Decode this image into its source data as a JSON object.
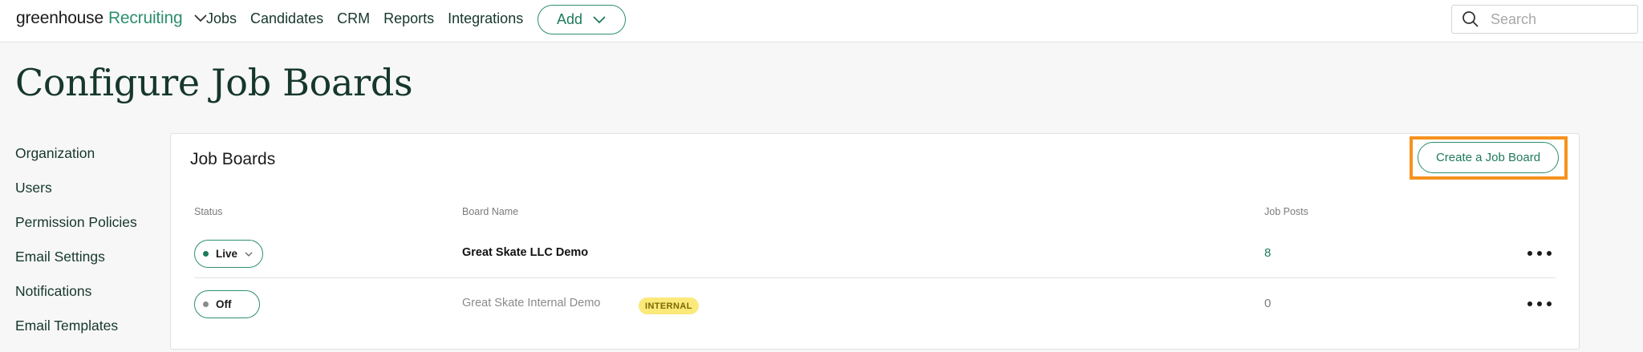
{
  "topbar": {
    "brand": "greenhouse",
    "product": "Recruiting",
    "nav": [
      {
        "label": "Jobs"
      },
      {
        "label": "Candidates"
      },
      {
        "label": "CRM"
      },
      {
        "label": "Reports"
      },
      {
        "label": "Integrations"
      }
    ],
    "add_label": "Add",
    "search_placeholder": "Search"
  },
  "page": {
    "title": "Configure Job Boards"
  },
  "sidebar": {
    "items": [
      {
        "label": "Organization"
      },
      {
        "label": "Users"
      },
      {
        "label": "Permission Policies"
      },
      {
        "label": "Email Settings"
      },
      {
        "label": "Notifications"
      },
      {
        "label": "Email Templates"
      }
    ]
  },
  "card": {
    "title": "Job Boards",
    "create_label": "Create a Job Board",
    "columns": {
      "status": "Status",
      "board_name": "Board Name",
      "job_posts": "Job Posts"
    },
    "rows": [
      {
        "status": "Live",
        "status_color": "#1f7a5c",
        "board_name": "Great Skate LLC Demo",
        "badge": "",
        "job_posts": "8"
      },
      {
        "status": "Off",
        "status_color": "#8a8a8a",
        "board_name": "Great Skate Internal Demo",
        "badge": "INTERNAL",
        "job_posts": "0"
      }
    ]
  },
  "colors": {
    "accent": "#2d8f6e",
    "highlight": "#f6921e",
    "badge": "#fbe97a"
  },
  "icons": {
    "logo_chevron": "chevron-down-icon",
    "add_chevron": "chevron-down-icon",
    "search": "search-icon",
    "row_menu": "more-horizontal-icon"
  }
}
